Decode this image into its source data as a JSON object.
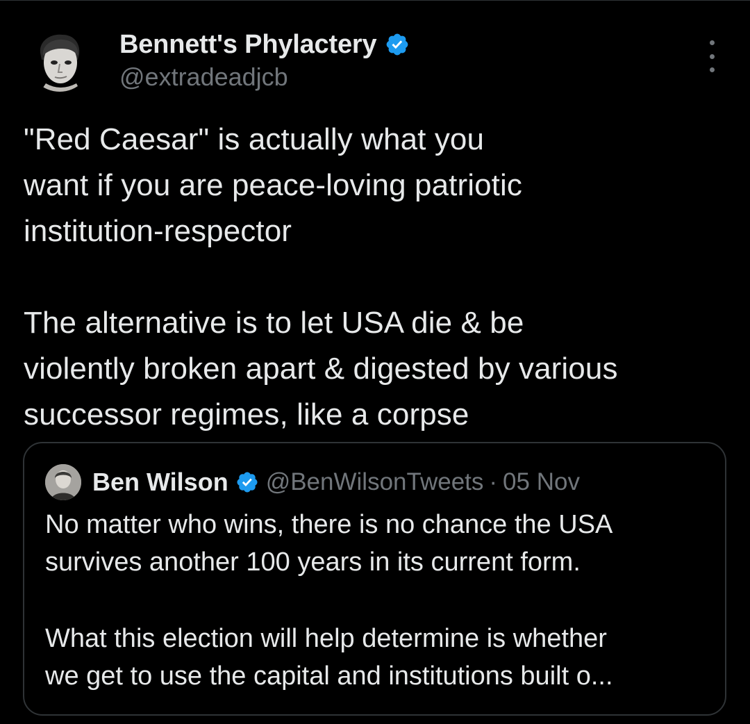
{
  "tweet": {
    "author": {
      "name": "Bennett's Phylactery",
      "handle": "@extradeadjcb",
      "verified": true,
      "avatar_icon": "portrait-avatar-icon"
    },
    "more_icon": "more-options-icon",
    "text_lines": [
      "\"Red Caesar\" is actually what you",
      "want if you are peace-loving patriotic",
      "institution-respector",
      "",
      "The alternative is to let USA die & be",
      "violently broken apart & digested by various",
      "successor regimes, like a corpse"
    ],
    "quote": {
      "author_name": "Ben Wilson",
      "author_handle": "@BenWilsonTweets",
      "separator": "·",
      "date": "05 Nov",
      "verified": true,
      "text_lines": [
        "No matter who wins, there is no chance the USA",
        "survives another 100 years in its current form.",
        "",
        "What this election will help determine is whether",
        "we get to use the capital and institutions built o..."
      ]
    }
  },
  "colors": {
    "background": "#000000",
    "primary_text": "#e7e9ea",
    "secondary_text": "#71767b",
    "border": "#2f3336",
    "verified_blue": "#1d9bf0"
  }
}
